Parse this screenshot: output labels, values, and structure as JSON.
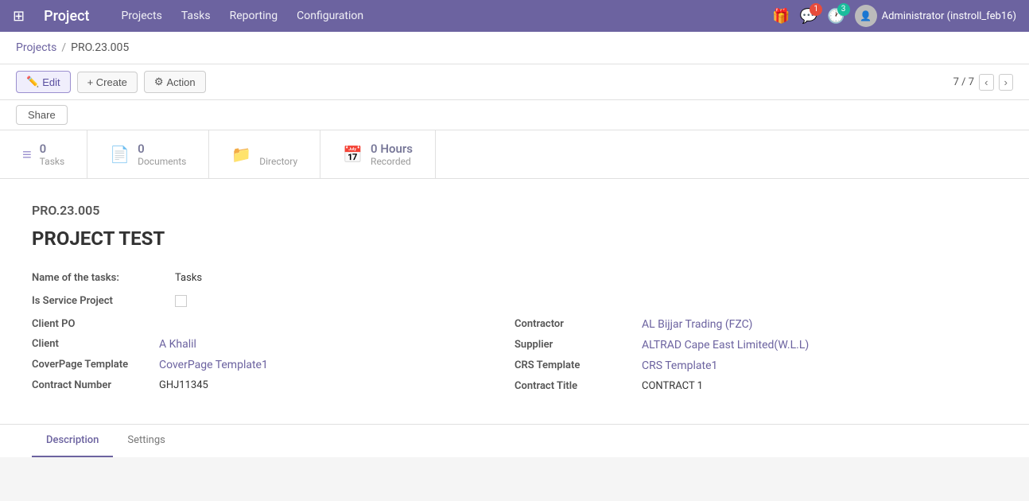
{
  "app": {
    "grid_icon": "⊞",
    "title": "Project"
  },
  "nav": {
    "items": [
      {
        "label": "Projects",
        "id": "nav-projects"
      },
      {
        "label": "Tasks",
        "id": "nav-tasks"
      },
      {
        "label": "Reporting",
        "id": "nav-reporting"
      },
      {
        "label": "Configuration",
        "id": "nav-configuration"
      }
    ]
  },
  "topbar_right": {
    "gift_icon": "🎁",
    "message_icon": "💬",
    "message_badge": "1",
    "clock_icon": "🕐",
    "clock_badge": "3",
    "user_label": "Administrator (instroll_feb16)"
  },
  "breadcrumb": {
    "parent_label": "Projects",
    "separator": "/",
    "current": "PRO.23.005"
  },
  "toolbar": {
    "edit_label": "Edit",
    "create_label": "+ Create",
    "action_label": "Action",
    "pagination": "7 / 7"
  },
  "share_bar": {
    "share_label": "Share"
  },
  "stats_tabs": [
    {
      "id": "tab-tasks",
      "icon": "☰",
      "count": "0",
      "label": "Tasks"
    },
    {
      "id": "tab-documents",
      "icon": "📄",
      "count": "0",
      "label": "Documents"
    },
    {
      "id": "tab-directory",
      "icon": "📁",
      "count": "",
      "label": "Directory"
    },
    {
      "id": "tab-hours",
      "icon": "📅",
      "count": "0 Hours",
      "label": "Recorded"
    }
  ],
  "project": {
    "id": "PRO.23.005",
    "name": "PROJECT TEST",
    "name_of_tasks_label": "Name of the tasks:",
    "name_of_tasks_value": "Tasks",
    "is_service_label": "Is Service Project",
    "client_po_label": "Client PO",
    "client_label": "Client",
    "client_value": "A Khalil",
    "coverpage_label": "CoverPage Template",
    "coverpage_value": "CoverPage Template1",
    "contract_number_label": "Contract Number",
    "contract_number_value": "GHJ11345",
    "contractor_label": "Contractor",
    "contractor_value": "AL Bijjar Trading (FZC)",
    "supplier_label": "Supplier",
    "supplier_value": "ALTRAD Cape East Limited(W.L.L)",
    "crs_template_label": "CRS Template",
    "crs_template_value": "CRS Template1",
    "contract_title_label": "Contract Title",
    "contract_title_value": "CONTRACT 1"
  },
  "bottom_tabs": [
    {
      "label": "Description",
      "active": true
    },
    {
      "label": "Settings",
      "active": false
    }
  ]
}
